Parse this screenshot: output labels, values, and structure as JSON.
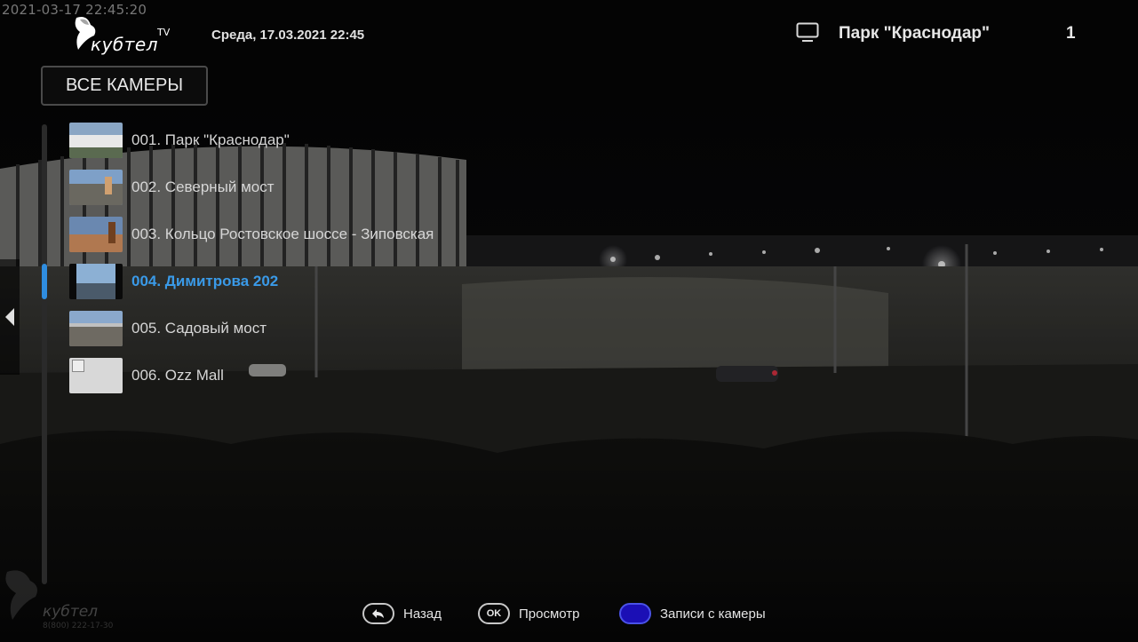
{
  "overlay": {
    "timestamp": "2021-03-17 22:45:20"
  },
  "header": {
    "logo_text": "кубтел",
    "logo_tv": "TV",
    "date_time": "Среда, 17.03.2021   22:45",
    "channel_icon": "tv-icon",
    "channel_name": "Парк \"Краснодар\"",
    "channel_number": "1"
  },
  "all_cameras_label": "ВСЕ КАМЕРЫ",
  "cameras": [
    {
      "label": "001. Парк \"Краснодар\"",
      "active": false
    },
    {
      "label": "002. Северный мост",
      "active": false
    },
    {
      "label": "003. Кольцо Ростовское шоссе - Зиповская",
      "active": false
    },
    {
      "label": "004. Димитрова 202",
      "active": true
    },
    {
      "label": "005. Садовый мост",
      "active": false
    },
    {
      "label": "006. Ozz Mall",
      "active": false
    }
  ],
  "footer": {
    "logo_text": "кубтел",
    "phone": "8(800) 222-17-30",
    "hints": [
      {
        "key": "back-arrow-icon",
        "label": "Назад"
      },
      {
        "key": "OK",
        "label": "Просмотр"
      },
      {
        "key": "blue-button",
        "label": "Записи с камеры"
      }
    ]
  },
  "colors": {
    "accent": "#3a9ae8",
    "blue_key": "#1b0fb5"
  }
}
